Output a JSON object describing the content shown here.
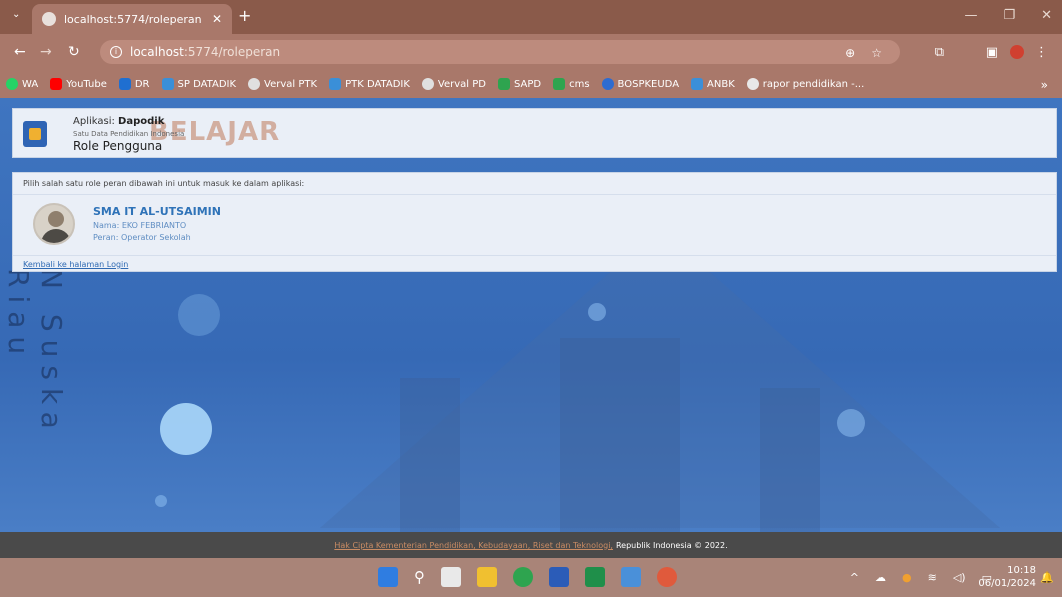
{
  "browser": {
    "tab_title": "localhost:5774/roleperan",
    "url_host": "localhost",
    "url_path": ":5774/roleperan",
    "bookmarks": [
      "WA",
      "YouTube",
      "DR",
      "SP DATADIK",
      "Verval PTK",
      "PTK DATADIK",
      "Verval PD",
      "SAPD",
      "cms",
      "BOSPKEUDA",
      "ANBK",
      "rapor pendidikan -..."
    ],
    "bookmark_colors": [
      "#25d366",
      "#ff0000",
      "#1f6fd1",
      "#3a8fd8",
      "#3b7dd8",
      "#3a8fd8",
      "#3b7dd8",
      "#2ea44f",
      "#2ea44f",
      "#2d6cd1",
      "#3b8fd8",
      "#e8e8e8"
    ]
  },
  "header": {
    "app_label": "Aplikasi:",
    "app_name": "Dapodik",
    "app_sub": "Satu Data Pendidikan Indonesia",
    "title": "Role Pengguna",
    "watermark": "BELAJAR"
  },
  "role": {
    "instruction": "Pilih salah satu role peran dibawah ini untuk masuk ke dalam aplikasi:",
    "school": "SMA IT AL-UTSAIMIN",
    "nama": "Nama: EKO FEBRIANTO",
    "peran": "Peran: Operator Sekolah",
    "back_link": "Kembali ke halaman Login"
  },
  "side_watermark": "N Suska Riau",
  "footer": {
    "link": "Hak Cipta Kementerian Pendidikan, Kebudayaan, Riset dan Teknologi,",
    "text": "Republik Indonesia © 2022."
  },
  "taskbar": {
    "time": "10:18",
    "date": "06/01/2024",
    "icon_colors": [
      "#2f7de1",
      "#ffffff",
      "#e9e9e9",
      "#f0c030",
      "#2ea44f",
      "#2b5cb8",
      "#1f8f4a",
      "#4a90d9",
      "#e05a3c"
    ]
  }
}
